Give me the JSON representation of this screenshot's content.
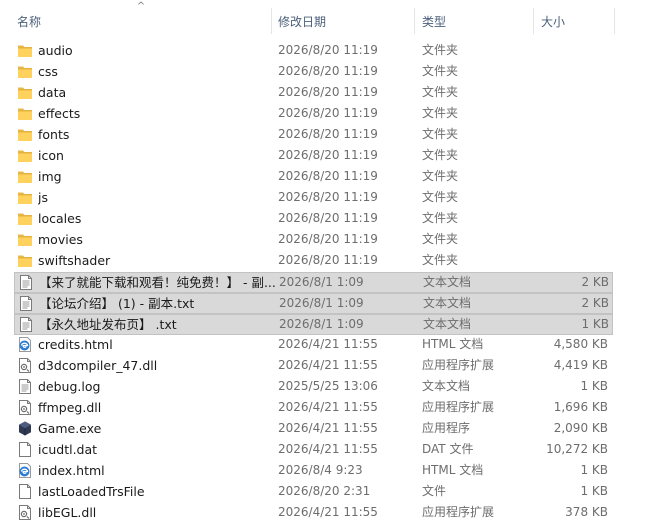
{
  "header": {
    "sort_glyph": "^",
    "columns": {
      "name": "名称",
      "date": "修改日期",
      "type": "类型",
      "size": "大小"
    }
  },
  "rows": [
    {
      "name": "audio",
      "date": "2026/8/20 11:19",
      "type": "文件夹",
      "size": "",
      "icon": "folder-icon",
      "selected": false
    },
    {
      "name": "css",
      "date": "2026/8/20 11:19",
      "type": "文件夹",
      "size": "",
      "icon": "folder-icon",
      "selected": false
    },
    {
      "name": "data",
      "date": "2026/8/20 11:19",
      "type": "文件夹",
      "size": "",
      "icon": "folder-icon",
      "selected": false
    },
    {
      "name": "effects",
      "date": "2026/8/20 11:19",
      "type": "文件夹",
      "size": "",
      "icon": "folder-icon",
      "selected": false
    },
    {
      "name": "fonts",
      "date": "2026/8/20 11:19",
      "type": "文件夹",
      "size": "",
      "icon": "folder-icon",
      "selected": false
    },
    {
      "name": "icon",
      "date": "2026/8/20 11:19",
      "type": "文件夹",
      "size": "",
      "icon": "folder-icon",
      "selected": false
    },
    {
      "name": "img",
      "date": "2026/8/20 11:19",
      "type": "文件夹",
      "size": "",
      "icon": "folder-icon",
      "selected": false
    },
    {
      "name": "js",
      "date": "2026/8/20 11:19",
      "type": "文件夹",
      "size": "",
      "icon": "folder-icon",
      "selected": false
    },
    {
      "name": "locales",
      "date": "2026/8/20 11:19",
      "type": "文件夹",
      "size": "",
      "icon": "folder-icon",
      "selected": false
    },
    {
      "name": "movies",
      "date": "2026/8/20 11:19",
      "type": "文件夹",
      "size": "",
      "icon": "folder-icon",
      "selected": false
    },
    {
      "name": "swiftshader",
      "date": "2026/8/20 11:19",
      "type": "文件夹",
      "size": "",
      "icon": "folder-icon",
      "selected": false
    },
    {
      "name": "【来了就能下载和观看！纯免费！】 - 副...",
      "date": "2026/8/1 1:09",
      "type": "文本文档",
      "size": "2 KB",
      "icon": "text-file-icon",
      "selected": true
    },
    {
      "name": "【论坛介绍】 (1) - 副本.txt",
      "date": "2026/8/1 1:09",
      "type": "文本文档",
      "size": "2 KB",
      "icon": "text-file-icon",
      "selected": true
    },
    {
      "name": "【永久地址发布页】 .txt",
      "date": "2026/8/1 1:09",
      "type": "文本文档",
      "size": "1 KB",
      "icon": "text-file-icon",
      "selected": true
    },
    {
      "name": "credits.html",
      "date": "2026/4/21 11:55",
      "type": "HTML 文档",
      "size": "4,580 KB",
      "icon": "edge-html-icon",
      "selected": false
    },
    {
      "name": "d3dcompiler_47.dll",
      "date": "2026/4/21 11:55",
      "type": "应用程序扩展",
      "size": "4,419 KB",
      "icon": "dll-file-icon",
      "selected": false
    },
    {
      "name": "debug.log",
      "date": "2025/5/25 13:06",
      "type": "文本文档",
      "size": "1 KB",
      "icon": "text-file-icon",
      "selected": false
    },
    {
      "name": "ffmpeg.dll",
      "date": "2026/4/21 11:55",
      "type": "应用程序扩展",
      "size": "1,696 KB",
      "icon": "dll-file-icon",
      "selected": false
    },
    {
      "name": "Game.exe",
      "date": "2026/4/21 11:55",
      "type": "应用程序",
      "size": "2,090 KB",
      "icon": "game-exe-icon",
      "selected": false
    },
    {
      "name": "icudtl.dat",
      "date": "2026/4/21 11:55",
      "type": "DAT 文件",
      "size": "10,272 KB",
      "icon": "blank-file-icon",
      "selected": false
    },
    {
      "name": "index.html",
      "date": "2026/8/4 9:23",
      "type": "HTML 文档",
      "size": "1 KB",
      "icon": "edge-html-icon",
      "selected": false
    },
    {
      "name": "lastLoadedTrsFile",
      "date": "2026/8/20 2:31",
      "type": "文件",
      "size": "1 KB",
      "icon": "blank-file-icon",
      "selected": false
    },
    {
      "name": "libEGL.dll",
      "date": "2026/4/21 11:55",
      "type": "应用程序扩展",
      "size": "378 KB",
      "icon": "dll-file-icon",
      "selected": false
    }
  ]
}
